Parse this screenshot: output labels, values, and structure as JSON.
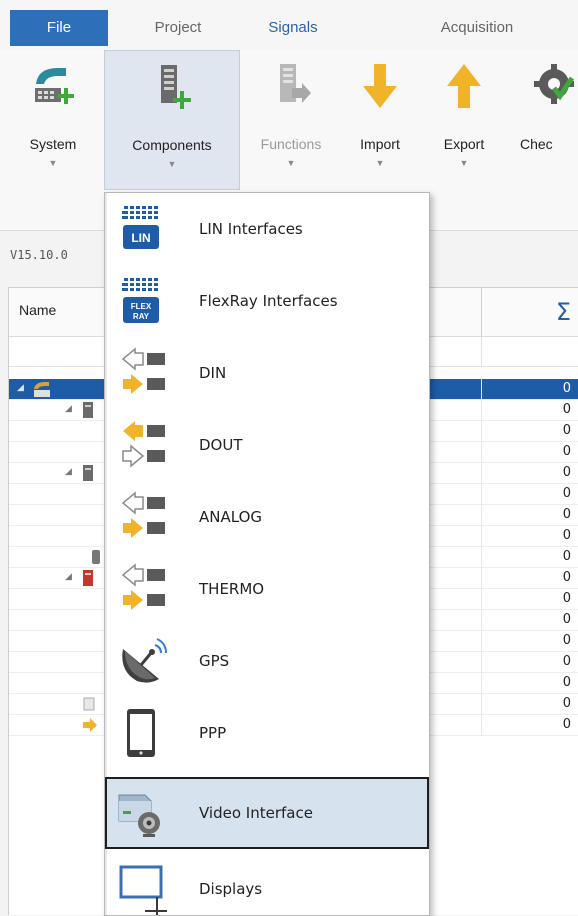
{
  "menubar": {
    "tabs": [
      {
        "label": "File"
      },
      {
        "label": "Project"
      },
      {
        "label": "Signals"
      },
      {
        "label": "Acquisition"
      }
    ]
  },
  "ribbon": {
    "buttons": [
      {
        "label": "System",
        "icon": "system-icon"
      },
      {
        "label": "Components",
        "icon": "components-icon"
      },
      {
        "label": "Functions",
        "icon": "functions-icon",
        "disabled": true
      },
      {
        "label": "Import",
        "icon": "import-arrow-icon"
      },
      {
        "label": "Export",
        "icon": "export-arrow-icon"
      },
      {
        "label": "Chec",
        "icon": "check-gear-icon"
      }
    ]
  },
  "grid": {
    "version": "V15.10.0",
    "name_header": "Name",
    "sum_header": "Σ",
    "row_values": [
      "0",
      "0",
      "0",
      "0",
      "0",
      "0",
      "0",
      "0",
      "0",
      "0",
      "0",
      "0",
      "0",
      "0",
      "0",
      "0",
      "0"
    ]
  },
  "dropdown": {
    "items": [
      {
        "label": "LIN Interfaces",
        "icon": "lin-interface-icon"
      },
      {
        "label": "FlexRay Interfaces",
        "icon": "flexray-interface-icon"
      },
      {
        "label": "DIN",
        "icon": "din-icon"
      },
      {
        "label": "DOUT",
        "icon": "dout-icon"
      },
      {
        "label": "ANALOG",
        "icon": "analog-icon"
      },
      {
        "label": "THERMO",
        "icon": "thermo-icon"
      },
      {
        "label": "GPS",
        "icon": "gps-satellite-icon"
      },
      {
        "label": "PPP",
        "icon": "ppp-tablet-icon"
      },
      {
        "label": "Video Interface",
        "icon": "video-interface-icon",
        "highlighted": true
      },
      {
        "label": "Displays",
        "icon": "displays-icon"
      }
    ]
  },
  "colors": {
    "file_tab": "#2d6fb9",
    "selected_row": "#1f5ca8",
    "menu_highlight": "#d6e3ef",
    "arrow_yellow": "#f1b32a"
  }
}
